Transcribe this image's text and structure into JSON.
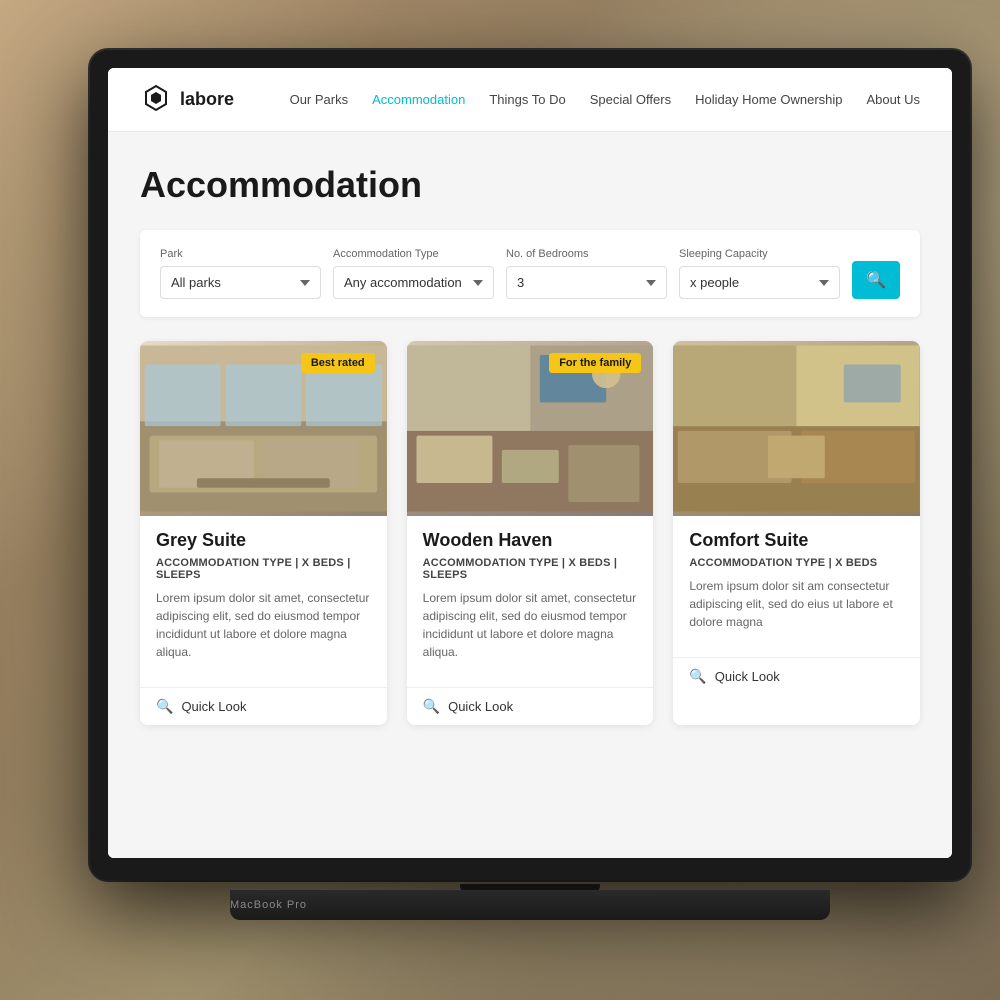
{
  "background": {
    "type": "blurred-room"
  },
  "laptop": {
    "bottom_label": "MacBook Pro"
  },
  "nav": {
    "logo_text": "labore",
    "links": [
      {
        "label": "Our Parks",
        "active": false
      },
      {
        "label": "Accommodation",
        "active": true
      },
      {
        "label": "Things To Do",
        "active": false
      },
      {
        "label": "Special Offers",
        "active": false
      },
      {
        "label": "Holiday Home Ownership",
        "active": false
      },
      {
        "label": "About Us",
        "active": false
      }
    ]
  },
  "page": {
    "title": "Accommodation"
  },
  "filters": {
    "park_label": "Park",
    "park_value": "All parks",
    "accommodation_label": "Accommodation Type",
    "accommodation_value": "Any accommodation type",
    "bedrooms_label": "No. of Bedrooms",
    "bedrooms_value": "3",
    "sleeping_label": "Sleeping Capacity",
    "sleeping_value": "x people",
    "search_icon": "🔍"
  },
  "cards": [
    {
      "id": 1,
      "title": "Grey Suite",
      "badge": "Best rated",
      "badge_color": "yellow",
      "meta": "Accommodation Type | x beds | Sleeps",
      "description": "Lorem ipsum dolor sit amet, consectetur adipiscing elit, sed do eiusmod tempor incididunt ut labore et dolore magna aliqua.",
      "quick_look": "Quick Look"
    },
    {
      "id": 2,
      "title": "Wooden Haven",
      "badge": "For the family",
      "badge_color": "yellow",
      "meta": "Accommodation Type | x beds | Sleeps",
      "description": "Lorem ipsum dolor sit amet, consectetur adipiscing elit, sed do eiusmod tempor incididunt ut labore et dolore magna aliqua.",
      "quick_look": "Quick Look"
    },
    {
      "id": 3,
      "title": "Comfort Suite",
      "badge": null,
      "meta": "Accommodation Type | x beds",
      "description": "Lorem ipsum dolor sit am consectetur adipiscing elit, sed do eius ut labore et dolore magna",
      "quick_look": "Quick Look"
    }
  ]
}
